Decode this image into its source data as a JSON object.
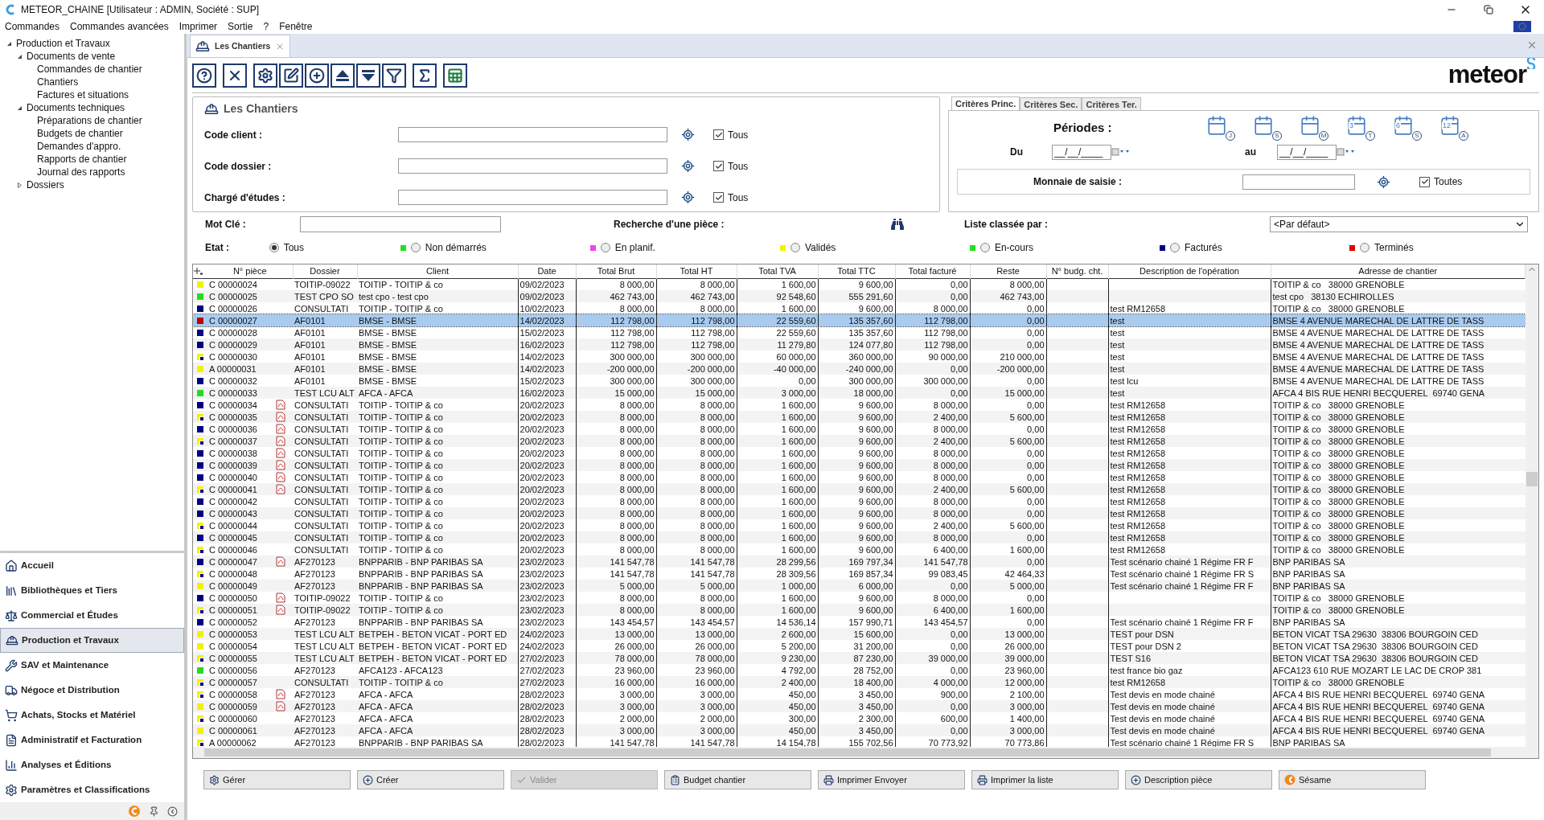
{
  "window": {
    "title": "METEOR_CHAINE [Utilisateur : ADMIN, Société : SUP]"
  },
  "menu": [
    "Commandes",
    "Commandes avancées",
    "Imprimer",
    "Sortie",
    "?",
    "Fenêtre"
  ],
  "tree": [
    {
      "label": "Production et Travaux",
      "expanded": true,
      "children": [
        {
          "label": "Documents de vente",
          "expanded": true,
          "children": [
            {
              "label": "Commandes de chantier"
            },
            {
              "label": "Chantiers"
            },
            {
              "label": "Factures et situations"
            }
          ]
        },
        {
          "label": "Documents techniques",
          "expanded": true,
          "children": [
            {
              "label": "Préparations de chantier"
            },
            {
              "label": "Budgets de chantier"
            },
            {
              "label": "Demandes d'appro."
            },
            {
              "label": "Rapports de chantier"
            },
            {
              "label": "Journal des rapports"
            }
          ]
        },
        {
          "label": "Dossiers",
          "expanded": false
        }
      ]
    }
  ],
  "nav": [
    {
      "label": "Accueil",
      "kind": "home",
      "selected": false
    },
    {
      "label": "Bibliothèques et Tiers",
      "kind": "library",
      "selected": false
    },
    {
      "label": "Commercial et Études",
      "kind": "commercial",
      "selected": false
    },
    {
      "label": "Production et Travaux",
      "kind": "production",
      "selected": true
    },
    {
      "label": "SAV et Maintenance",
      "kind": "sav",
      "selected": false
    },
    {
      "label": "Négoce et Distribution",
      "kind": "negoce",
      "selected": false
    },
    {
      "label": "Achats, Stocks et Matériel",
      "kind": "achats",
      "selected": false
    },
    {
      "label": "Administratif et Facturation",
      "kind": "admin",
      "selected": false
    },
    {
      "label": "Analyses et Éditions",
      "kind": "analyses",
      "selected": false
    },
    {
      "label": "Paramètres et Classifications",
      "kind": "params",
      "selected": false
    }
  ],
  "doc_tab": {
    "label": "Les Chantiers"
  },
  "logo": "meteor",
  "panel_title": "Les Chantiers",
  "fields": [
    {
      "label": "Code client :",
      "checkbox": "Tous",
      "checked": true
    },
    {
      "label": "Code dossier :",
      "checkbox": "Tous",
      "checked": true
    },
    {
      "label": "Chargé d'études :",
      "checkbox": "Tous",
      "checked": true
    }
  ],
  "criteria_tabs": [
    {
      "label": "Critères Princ.",
      "selected": true
    },
    {
      "label": "Critères Sec.",
      "selected": false
    },
    {
      "label": "Critères Ter.",
      "selected": false
    }
  ],
  "periodes": {
    "label": "Périodes :",
    "buttons": [
      {
        "letter": "J"
      },
      {
        "letter": "S"
      },
      {
        "letter": "M"
      },
      {
        "number": "3",
        "letter": "T"
      },
      {
        "number": "6",
        "letter": "S"
      },
      {
        "number": "12",
        "letter": "A"
      }
    ],
    "du": "Du",
    "du_value": "__/__/____",
    "au": "au",
    "au_value": "__/__/____"
  },
  "monnaie": {
    "label": "Monnaie de saisie :",
    "checkbox": "Toutes",
    "checked": true
  },
  "mot_cle": {
    "label": "Mot Clé :"
  },
  "recherche": {
    "label": "Recherche d'une pièce :"
  },
  "liste_classee": {
    "label": "Liste classée par :",
    "value": "<Par défaut>"
  },
  "etat": {
    "label": "Etat :",
    "options": [
      {
        "label": "Tous",
        "selected": true
      },
      {
        "label": "Non démarrés",
        "color": "#22dd22",
        "selected": false
      },
      {
        "label": "En planif.",
        "color": "#ee44ee",
        "selected": false
      },
      {
        "label": "Validés",
        "color": "#f2f200",
        "selected": false
      },
      {
        "label": "En-cours",
        "color": "#22dd22",
        "selected": false
      },
      {
        "label": "Facturés",
        "color": "#000080",
        "selected": false
      },
      {
        "label": "Terminés",
        "color": "#dd0000",
        "selected": false
      }
    ]
  },
  "table": {
    "columns": [
      "N° pièce",
      "Dossier",
      "Client",
      "Date",
      "Total Brut",
      "Total HT",
      "Total TVA",
      "Total TTC",
      "Total facturé",
      "Reste",
      "N° budg. cht.",
      "Description de l'opération",
      "Adresse de chantier"
    ],
    "rows": [
      {
        "piece": "C 00000024",
        "dossier": "TOITIP-09022",
        "client": "TOITIP - TOITIP & co",
        "date": "09/02/2023",
        "brut": "8 000,00",
        "ht": "8 000,00",
        "tva": "1 600,00",
        "ttc": "9 600,00",
        "facture": "0,00",
        "reste": "8 000,00",
        "adresse": "TOITIP & co   38000 GRENOBLE",
        "color": "#f2f200",
        "corner": false,
        "attachment": false,
        "selected": false
      },
      {
        "piece": "C 00000025",
        "dossier": "TEST CPO SO",
        "client": "test cpo - test cpo",
        "date": "09/02/2023",
        "brut": "462 743,00",
        "ht": "462 743,00",
        "tva": "92 548,60",
        "ttc": "555 291,60",
        "facture": "0,00",
        "reste": "462 743,00",
        "adresse": "test cpo   38130 ECHIROLLES",
        "color": "#22dd22",
        "corner": false,
        "attachment": false,
        "selected": false
      },
      {
        "piece": "C 00000026",
        "dossier": "CONSULTATI",
        "client": "TOITIP - TOITIP & co",
        "date": "10/02/2023",
        "brut": "8 000,00",
        "ht": "8 000,00",
        "tva": "1 600,00",
        "ttc": "9 600,00",
        "facture": "8 000,00",
        "reste": "0,00",
        "description": "test RM12658",
        "adresse": "TOITIP & co   38000 GRENOBLE",
        "color": "#000080",
        "corner": false,
        "attachment": false,
        "selected": false
      },
      {
        "piece": "C 00000027",
        "dossier": "AF0101",
        "client": "BMSE - BMSE",
        "date": "14/02/2023",
        "brut": "112 798,00",
        "ht": "112 798,00",
        "tva": "22 559,60",
        "ttc": "135 357,60",
        "facture": "112 798,00",
        "reste": "0,00",
        "description": "test",
        "adresse": "BMSE 4 AVENUE MARECHAL DE LATTRE DE TASS",
        "color": "#c00000",
        "corner": false,
        "attachment": false,
        "selected": true
      },
      {
        "piece": "C 00000028",
        "dossier": "AF0101",
        "client": "BMSE - BMSE",
        "date": "15/02/2023",
        "brut": "112 798,00",
        "ht": "112 798,00",
        "tva": "22 559,60",
        "ttc": "135 357,60",
        "facture": "112 798,00",
        "reste": "0,00",
        "description": "test",
        "adresse": "BMSE 4 AVENUE MARECHAL DE LATTRE DE TASS",
        "color": "#000080",
        "corner": false,
        "attachment": false,
        "selected": false
      },
      {
        "piece": "C 00000029",
        "dossier": "AF0101",
        "client": "BMSE - BMSE",
        "date": "16/02/2023",
        "brut": "112 798,00",
        "ht": "112 798,00",
        "tva": "11 279,80",
        "ttc": "124 077,80",
        "facture": "112 798,00",
        "reste": "0,00",
        "description": "test",
        "adresse": "BMSE 4 AVENUE MARECHAL DE LATTRE DE TASS",
        "color": "#000080",
        "corner": false,
        "attachment": false,
        "selected": false
      },
      {
        "piece": "C 00000030",
        "dossier": "AF0101",
        "client": "BMSE - BMSE",
        "date": "14/02/2023",
        "brut": "300 000,00",
        "ht": "300 000,00",
        "tva": "60 000,00",
        "ttc": "360 000,00",
        "facture": "90 000,00",
        "reste": "210 000,00",
        "description": "test",
        "adresse": "BMSE 4 AVENUE MARECHAL DE LATTRE DE TASS",
        "color": "#f2f200",
        "corner": true,
        "attachment": false,
        "selected": false
      },
      {
        "piece": "A 00000031",
        "dossier": "AF0101",
        "client": "BMSE - BMSE",
        "date": "14/02/2023",
        "brut": "-200 000,00",
        "ht": "-200 000,00",
        "tva": "-40 000,00",
        "ttc": "-240 000,00",
        "facture": "0,00",
        "reste": "-200 000,00",
        "description": "test",
        "adresse": "BMSE 4 AVENUE MARECHAL DE LATTRE DE TASS",
        "color": "#f2f200",
        "corner": false,
        "attachment": false,
        "selected": false
      },
      {
        "piece": "C 00000032",
        "dossier": "AF0101",
        "client": "BMSE - BMSE",
        "date": "15/02/2023",
        "brut": "300 000,00",
        "ht": "300 000,00",
        "tva": "0,00",
        "ttc": "300 000,00",
        "facture": "300 000,00",
        "reste": "0,00",
        "description": "test lcu",
        "adresse": "BMSE 4 AVENUE MARECHAL DE LATTRE DE TASS",
        "color": "#000080",
        "corner": false,
        "attachment": false,
        "selected": false
      },
      {
        "piece": "C 00000033",
        "dossier": "TEST LCU ALT",
        "client": "AFCA - AFCA",
        "date": "16/02/2023",
        "brut": "15 000,00",
        "ht": "15 000,00",
        "tva": "3 000,00",
        "ttc": "18 000,00",
        "facture": "0,00",
        "reste": "15 000,00",
        "description": "test",
        "adresse": "AFCA 4 BIS RUE HENRI BECQUEREL  69740 GENA",
        "color": "#22dd22",
        "corner": false,
        "attachment": false,
        "selected": false
      },
      {
        "piece": "C 00000034",
        "dossier": "CONSULTATI",
        "client": "TOITIP - TOITIP & co",
        "date": "20/02/2023",
        "brut": "8 000,00",
        "ht": "8 000,00",
        "tva": "1 600,00",
        "ttc": "9 600,00",
        "facture": "8 000,00",
        "reste": "0,00",
        "description": "test RM12658",
        "adresse": "TOITIP & co   38000 GRENOBLE",
        "color": "#000080",
        "corner": false,
        "attachment": true,
        "selected": false
      },
      {
        "piece": "C 00000035",
        "dossier": "CONSULTATI",
        "client": "TOITIP - TOITIP & co",
        "date": "20/02/2023",
        "brut": "8 000,00",
        "ht": "8 000,00",
        "tva": "1 600,00",
        "ttc": "9 600,00",
        "facture": "2 400,00",
        "reste": "5 600,00",
        "description": "test RM12658",
        "adresse": "TOITIP & co   38000 GRENOBLE",
        "color": "#f2f200",
        "corner": true,
        "attachment": true,
        "selected": false
      },
      {
        "piece": "C 00000036",
        "dossier": "CONSULTATI",
        "client": "TOITIP - TOITIP & co",
        "date": "20/02/2023",
        "brut": "8 000,00",
        "ht": "8 000,00",
        "tva": "1 600,00",
        "ttc": "9 600,00",
        "facture": "8 000,00",
        "reste": "0,00",
        "description": "test RM12658",
        "adresse": "TOITIP & co   38000 GRENOBLE",
        "color": "#000080",
        "corner": false,
        "attachment": true,
        "selected": false
      },
      {
        "piece": "C 00000037",
        "dossier": "CONSULTATI",
        "client": "TOITIP - TOITIP & co",
        "date": "20/02/2023",
        "brut": "8 000,00",
        "ht": "8 000,00",
        "tva": "1 600,00",
        "ttc": "9 600,00",
        "facture": "2 400,00",
        "reste": "5 600,00",
        "description": "test RM12658",
        "adresse": "TOITIP & co   38000 GRENOBLE",
        "color": "#f2f200",
        "corner": true,
        "attachment": true,
        "selected": false
      },
      {
        "piece": "C 00000038",
        "dossier": "CONSULTATI",
        "client": "TOITIP - TOITIP & co",
        "date": "20/02/2023",
        "brut": "8 000,00",
        "ht": "8 000,00",
        "tva": "1 600,00",
        "ttc": "9 600,00",
        "facture": "8 000,00",
        "reste": "0,00",
        "description": "test RM12658",
        "adresse": "TOITIP & co   38000 GRENOBLE",
        "color": "#000080",
        "corner": false,
        "attachment": true,
        "selected": false
      },
      {
        "piece": "C 00000039",
        "dossier": "CONSULTATI",
        "client": "TOITIP - TOITIP & co",
        "date": "20/02/2023",
        "brut": "8 000,00",
        "ht": "8 000,00",
        "tva": "1 600,00",
        "ttc": "9 600,00",
        "facture": "8 000,00",
        "reste": "0,00",
        "description": "test RM12658",
        "adresse": "TOITIP & co   38000 GRENOBLE",
        "color": "#000080",
        "corner": false,
        "attachment": true,
        "selected": false
      },
      {
        "piece": "C 00000040",
        "dossier": "CONSULTATI",
        "client": "TOITIP - TOITIP & co",
        "date": "20/02/2023",
        "brut": "8 000,00",
        "ht": "8 000,00",
        "tva": "1 600,00",
        "ttc": "9 600,00",
        "facture": "8 000,00",
        "reste": "0,00",
        "description": "test RM12658",
        "adresse": "TOITIP & co   38000 GRENOBLE",
        "color": "#000080",
        "corner": false,
        "attachment": true,
        "selected": false
      },
      {
        "piece": "C 00000041",
        "dossier": "CONSULTATI",
        "client": "TOITIP - TOITIP & co",
        "date": "20/02/2023",
        "brut": "8 000,00",
        "ht": "8 000,00",
        "tva": "1 600,00",
        "ttc": "9 600,00",
        "facture": "2 400,00",
        "reste": "5 600,00",
        "description": "test RM12658",
        "adresse": "TOITIP & co   38000 GRENOBLE",
        "color": "#f2f200",
        "corner": true,
        "attachment": true,
        "selected": false
      },
      {
        "piece": "C 00000042",
        "dossier": "CONSULTATI",
        "client": "TOITIP - TOITIP & co",
        "date": "20/02/2023",
        "brut": "8 000,00",
        "ht": "8 000,00",
        "tva": "1 600,00",
        "ttc": "9 600,00",
        "facture": "8 000,00",
        "reste": "0,00",
        "description": "test RM12658",
        "adresse": "TOITIP & co   38000 GRENOBLE",
        "color": "#000080",
        "corner": false,
        "attachment": false,
        "selected": false
      },
      {
        "piece": "C 00000043",
        "dossier": "CONSULTATI",
        "client": "TOITIP - TOITIP & co",
        "date": "20/02/2023",
        "brut": "8 000,00",
        "ht": "8 000,00",
        "tva": "1 600,00",
        "ttc": "9 600,00",
        "facture": "8 000,00",
        "reste": "0,00",
        "description": "test RM12658",
        "adresse": "TOITIP & co   38000 GRENOBLE",
        "color": "#000080",
        "corner": false,
        "attachment": false,
        "selected": false
      },
      {
        "piece": "C 00000044",
        "dossier": "CONSULTATI",
        "client": "TOITIP - TOITIP & co",
        "date": "20/02/2023",
        "brut": "8 000,00",
        "ht": "8 000,00",
        "tva": "1 600,00",
        "ttc": "9 600,00",
        "facture": "2 400,00",
        "reste": "5 600,00",
        "description": "test RM12658",
        "adresse": "TOITIP & co   38000 GRENOBLE",
        "color": "#f2f200",
        "corner": true,
        "attachment": false,
        "selected": false
      },
      {
        "piece": "C 00000045",
        "dossier": "CONSULTATI",
        "client": "TOITIP - TOITIP & co",
        "date": "20/02/2023",
        "brut": "8 000,00",
        "ht": "8 000,00",
        "tva": "1 600,00",
        "ttc": "9 600,00",
        "facture": "8 000,00",
        "reste": "0,00",
        "description": "test RM12658",
        "adresse": "TOITIP & co   38000 GRENOBLE",
        "color": "#000080",
        "corner": false,
        "attachment": false,
        "selected": false
      },
      {
        "piece": "C 00000046",
        "dossier": "CONSULTATI",
        "client": "TOITIP - TOITIP & co",
        "date": "20/02/2023",
        "brut": "8 000,00",
        "ht": "8 000,00",
        "tva": "1 600,00",
        "ttc": "9 600,00",
        "facture": "6 400,00",
        "reste": "1 600,00",
        "description": "test RM12658",
        "adresse": "TOITIP & co   38000 GRENOBLE",
        "color": "#f2f200",
        "corner": true,
        "attachment": false,
        "selected": false
      },
      {
        "piece": "C 00000047",
        "dossier": "AF270123",
        "client": "BNPPARIB - BNP PARIBAS SA",
        "date": "23/02/2023",
        "brut": "141 547,78",
        "ht": "141 547,78",
        "tva": "28 299,56",
        "ttc": "169 797,34",
        "facture": "141 547,78",
        "reste": "0,00",
        "description": "Test scénario chainé 1 Régime FR F",
        "adresse": "BNP PARIBAS SA",
        "color": "#000080",
        "corner": false,
        "attachment": true,
        "selected": false
      },
      {
        "piece": "C 00000048",
        "dossier": "AF270123",
        "client": "BNPPARIB - BNP PARIBAS SA",
        "date": "23/02/2023",
        "brut": "141 547,78",
        "ht": "141 547,78",
        "tva": "28 309,56",
        "ttc": "169 857,34",
        "facture": "99 083,45",
        "reste": "42 464,33",
        "description": "Test scénario chainé 1 Régime FR S",
        "adresse": "BNP PARIBAS SA",
        "color": "#f2f200",
        "corner": true,
        "attachment": false,
        "selected": false
      },
      {
        "piece": "C 00000049",
        "dossier": "AF270123",
        "client": "BNPPARIB - BNP PARIBAS SA",
        "date": "23/02/2023",
        "brut": "5 000,00",
        "ht": "5 000,00",
        "tva": "1 000,00",
        "ttc": "6 000,00",
        "facture": "0,00",
        "reste": "5 000,00",
        "description": "Test scénario chainé 1 Régime FR F",
        "adresse": "BNP PARIBAS SA",
        "color": "#f2f200",
        "corner": false,
        "attachment": false,
        "selected": false
      },
      {
        "piece": "C 00000050",
        "dossier": "TOITIP-09022",
        "client": "TOITIP - TOITIP & co",
        "date": "23/02/2023",
        "brut": "8 000,00",
        "ht": "8 000,00",
        "tva": "1 600,00",
        "ttc": "9 600,00",
        "facture": "8 000,00",
        "reste": "0,00",
        "adresse": "TOITIP & co   38000 GRENOBLE",
        "color": "#000080",
        "corner": false,
        "attachment": true,
        "selected": false
      },
      {
        "piece": "C 00000051",
        "dossier": "TOITIP-09022",
        "client": "TOITIP - TOITIP & co",
        "date": "23/02/2023",
        "brut": "8 000,00",
        "ht": "8 000,00",
        "tva": "1 600,00",
        "ttc": "9 600,00",
        "facture": "6 400,00",
        "reste": "1 600,00",
        "adresse": "TOITIP & co   38000 GRENOBLE",
        "color": "#f2f200",
        "corner": true,
        "attachment": true,
        "selected": false
      },
      {
        "piece": "C 00000052",
        "dossier": "AF270123",
        "client": "BNPPARIB - BNP PARIBAS SA",
        "date": "23/02/2023",
        "brut": "143 454,57",
        "ht": "143 454,57",
        "tva": "14 536,14",
        "ttc": "157 990,71",
        "facture": "143 454,57",
        "reste": "0,00",
        "description": "Test scénario chainé 1 Régime FR F",
        "adresse": "BNP PARIBAS SA",
        "color": "#000080",
        "corner": false,
        "attachment": false,
        "selected": false
      },
      {
        "piece": "C 00000053",
        "dossier": "TEST LCU ALT",
        "client": "BETPEH - BETON VICAT - PORT ED",
        "date": "24/02/2023",
        "brut": "13 000,00",
        "ht": "13 000,00",
        "tva": "2 600,00",
        "ttc": "15 600,00",
        "facture": "0,00",
        "reste": "13 000,00",
        "description": "TEST pour DSN",
        "adresse": "BETON VICAT TSA 29630  38306 BOURGOIN CED",
        "color": "#f2f200",
        "corner": false,
        "attachment": false,
        "selected": false
      },
      {
        "piece": "C 00000054",
        "dossier": "TEST LCU ALT",
        "client": "BETPEH - BETON VICAT - PORT ED",
        "date": "24/02/2023",
        "brut": "26 000,00",
        "ht": "26 000,00",
        "tva": "5 200,00",
        "ttc": "31 200,00",
        "facture": "0,00",
        "reste": "26 000,00",
        "description": "TEST pour DSN 2",
        "adresse": "BETON VICAT TSA 29630  38306 BOURGOIN CED",
        "color": "#f2f200",
        "corner": false,
        "attachment": false,
        "selected": false
      },
      {
        "piece": "C 00000055",
        "dossier": "TEST LCU ALT",
        "client": "BETPEH - BETON VICAT - PORT ED",
        "date": "27/02/2023",
        "brut": "78 000,00",
        "ht": "78 000,00",
        "tva": "9 230,00",
        "ttc": "87 230,00",
        "facture": "39 000,00",
        "reste": "39 000,00",
        "description": "TEST S16",
        "adresse": "BETON VICAT TSA 29630  38306 BOURGOIN CED",
        "color": "#f2f200",
        "corner": true,
        "attachment": false,
        "selected": false
      },
      {
        "piece": "C 00000056",
        "dossier": "AF270123",
        "client": "AFCA123 - AFCA123",
        "date": "27/02/2023",
        "brut": "23 960,00",
        "ht": "23 960,00",
        "tva": "4 792,00",
        "ttc": "28 752,00",
        "facture": "0,00",
        "reste": "23 960,00",
        "description": "test france bio gaz",
        "adresse": "AFCA123 610 RUE MOZART LE LAC DE CROP 381",
        "color": "#22dd22",
        "corner": false,
        "attachment": false,
        "selected": false
      },
      {
        "piece": "C 00000057",
        "dossier": "CONSULTATI",
        "client": "TOITIP - TOITIP & co",
        "date": "27/02/2023",
        "brut": "16 000,00",
        "ht": "16 000,00",
        "tva": "2 400,00",
        "ttc": "18 400,00",
        "facture": "4 000,00",
        "reste": "12 000,00",
        "description": "test RM12658",
        "adresse": "TOITIP & co   38000 GRENOBLE",
        "color": "#f2f200",
        "corner": true,
        "attachment": false,
        "selected": false
      },
      {
        "piece": "C 00000058",
        "dossier": "AF270123",
        "client": "AFCA - AFCA",
        "date": "28/02/2023",
        "brut": "3 000,00",
        "ht": "3 000,00",
        "tva": "450,00",
        "ttc": "3 450,00",
        "facture": "900,00",
        "reste": "2 100,00",
        "description": "Test devis en mode chainé",
        "adresse": "AFCA 4 BIS RUE HENRI BECQUEREL  69740 GENA",
        "color": "#f2f200",
        "corner": true,
        "attachment": true,
        "selected": false
      },
      {
        "piece": "C 00000059",
        "dossier": "AF270123",
        "client": "AFCA - AFCA",
        "date": "28/02/2023",
        "brut": "3 000,00",
        "ht": "3 000,00",
        "tva": "450,00",
        "ttc": "3 450,00",
        "facture": "0,00",
        "reste": "3 000,00",
        "description": "Test devis en mode chainé",
        "adresse": "AFCA 4 BIS RUE HENRI BECQUEREL  69740 GENA",
        "color": "#f2f200",
        "corner": false,
        "attachment": true,
        "selected": false
      },
      {
        "piece": "C 00000060",
        "dossier": "AF270123",
        "client": "AFCA - AFCA",
        "date": "28/02/2023",
        "brut": "2 000,00",
        "ht": "2 000,00",
        "tva": "300,00",
        "ttc": "2 300,00",
        "facture": "600,00",
        "reste": "1 400,00",
        "description": "Test devis en mode chainé",
        "adresse": "AFCA 4 BIS RUE HENRI BECQUEREL  69740 GENA",
        "color": "#f2f200",
        "corner": true,
        "attachment": false,
        "selected": false
      },
      {
        "piece": "C 00000061",
        "dossier": "AF270123",
        "client": "AFCA - AFCA",
        "date": "28/02/2023",
        "brut": "3 000,00",
        "ht": "3 000,00",
        "tva": "450,00",
        "ttc": "3 450,00",
        "facture": "0,00",
        "reste": "3 000,00",
        "description": "Test devis en mode chainé",
        "adresse": "AFCA 4 BIS RUE HENRI BECQUEREL  69740 GENA",
        "color": "#f2f200",
        "corner": false,
        "attachment": false,
        "selected": false
      },
      {
        "piece": "A 00000062",
        "dossier": "AF270123",
        "client": "BNPPARIB - BNP PARIBAS SA",
        "date": "28/02/2023",
        "brut": "141 547,78",
        "ht": "141 547,78",
        "tva": "14 154,78",
        "ttc": "155 702,56",
        "facture": "70 773,92",
        "reste": "70 773,86",
        "description": "Test scénario chainé 1 Régime FR S",
        "adresse": "BNP PARIBAS SA",
        "color": "#f2f200",
        "corner": true,
        "attachment": false,
        "selected": false
      }
    ]
  },
  "actions": [
    {
      "label": "Gérer",
      "kind": "gear",
      "disabled": false
    },
    {
      "label": "Créer",
      "kind": "plus",
      "disabled": false
    },
    {
      "label": "Valider",
      "kind": "check",
      "disabled": true
    },
    {
      "label": "Budget chantier",
      "kind": "budget",
      "disabled": false
    },
    {
      "label": "Imprimer Envoyer",
      "kind": "print",
      "disabled": false
    },
    {
      "label": "Imprimer la liste",
      "kind": "print",
      "disabled": false
    },
    {
      "label": "Description pièce",
      "kind": "plus",
      "disabled": false
    },
    {
      "label": "Sésame",
      "kind": "sesame",
      "disabled": false
    }
  ]
}
